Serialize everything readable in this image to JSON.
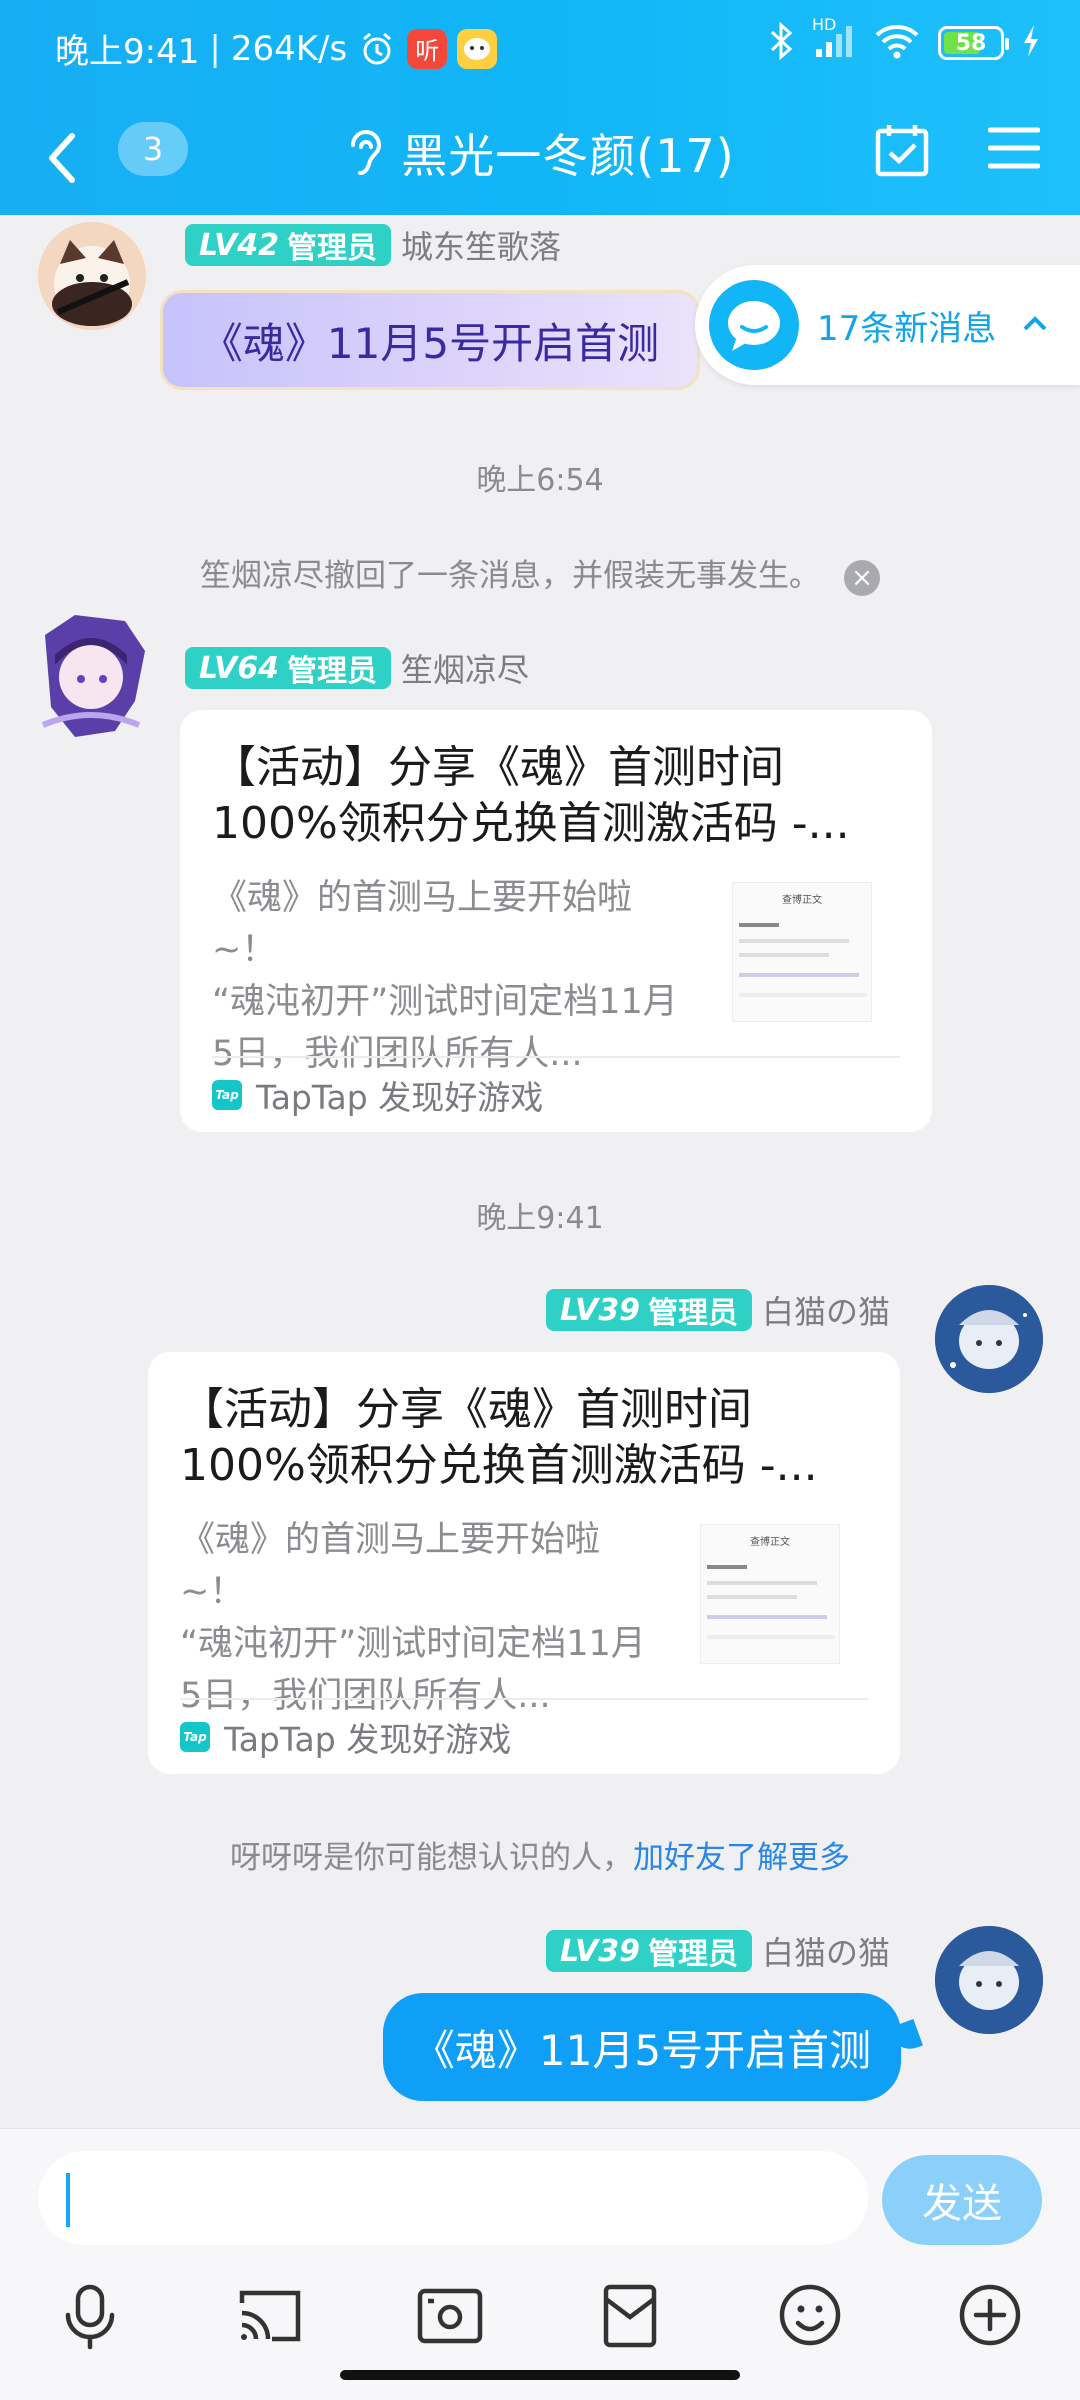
{
  "status_bar": {
    "time": "晚上9:41",
    "speed": "264K/s",
    "network_label": "HD",
    "battery": "58",
    "icons": [
      "alarm-icon",
      "radio-app-icon",
      "chat-app-icon",
      "bluetooth-icon",
      "signal-icon",
      "wifi-icon",
      "battery-icon",
      "charging-icon"
    ]
  },
  "header": {
    "back_label": "",
    "unread_count": "3",
    "title": "黑光一冬颜(17)",
    "icons": [
      "back-icon",
      "ear-icon",
      "calendar-check-icon",
      "menu-icon"
    ]
  },
  "pinned": {
    "avatar": "cat-avatar",
    "level": "LV42",
    "role": "管理员",
    "nick": "城东笙歌落",
    "ticker_text": "《魂》11月5号开启首测",
    "new_messages": "17条新消息"
  },
  "messages": [
    {
      "type": "time",
      "text": "晚上6:54"
    },
    {
      "type": "system",
      "text": "笙烟凉尽撤回了一条消息，并假装无事发生。"
    },
    {
      "type": "card",
      "side": "left",
      "level": "LV64",
      "role": "管理员",
      "nick": "笙烟凉尽",
      "title_line1": "【活动】分享《魂》首测时间",
      "title_line2": "100%领积分兑换首测激活码 -...",
      "desc_line1": "《魂》的首测马上要开始啦~！",
      "desc_line2": "“魂沌初开”测试时间定档11月",
      "desc_line3": "5日，我们团队所有人...",
      "thumb_title": "查博正文",
      "source_logo": "Tap",
      "source": "TapTap 发现好游戏"
    },
    {
      "type": "time",
      "text": "晚上9:41"
    },
    {
      "type": "card",
      "side": "right",
      "level": "LV39",
      "role": "管理员",
      "nick": "白猫の猫",
      "title_line1": "【活动】分享《魂》首测时间",
      "title_line2": "100%领积分兑换首测激活码 -...",
      "desc_line1": "《魂》的首测马上要开始啦~！",
      "desc_line2": "“魂沌初开”测试时间定档11月",
      "desc_line3": "5日，我们团队所有人...",
      "thumb_title": "查博正文",
      "source_logo": "Tap",
      "source": "TapTap 发现好游戏"
    },
    {
      "type": "recommend",
      "text": "呀呀呀是你可能想认识的人，",
      "link": "加好友了解更多"
    },
    {
      "type": "text",
      "side": "right",
      "level": "LV39",
      "role": "管理员",
      "nick": "白猫の猫",
      "text": "《魂》11月5号开启首测"
    }
  ],
  "input": {
    "value": "",
    "placeholder": "",
    "send_label": "发送"
  },
  "toolbar": [
    "microphone-icon",
    "cast-icon",
    "photo-icon",
    "red-packet-icon",
    "emoji-icon",
    "plus-icon"
  ],
  "colors": {
    "header": "#17aef4",
    "accent": "#0f9ff6",
    "level_badge": "#2fd0c6",
    "link": "#2a86e6"
  }
}
